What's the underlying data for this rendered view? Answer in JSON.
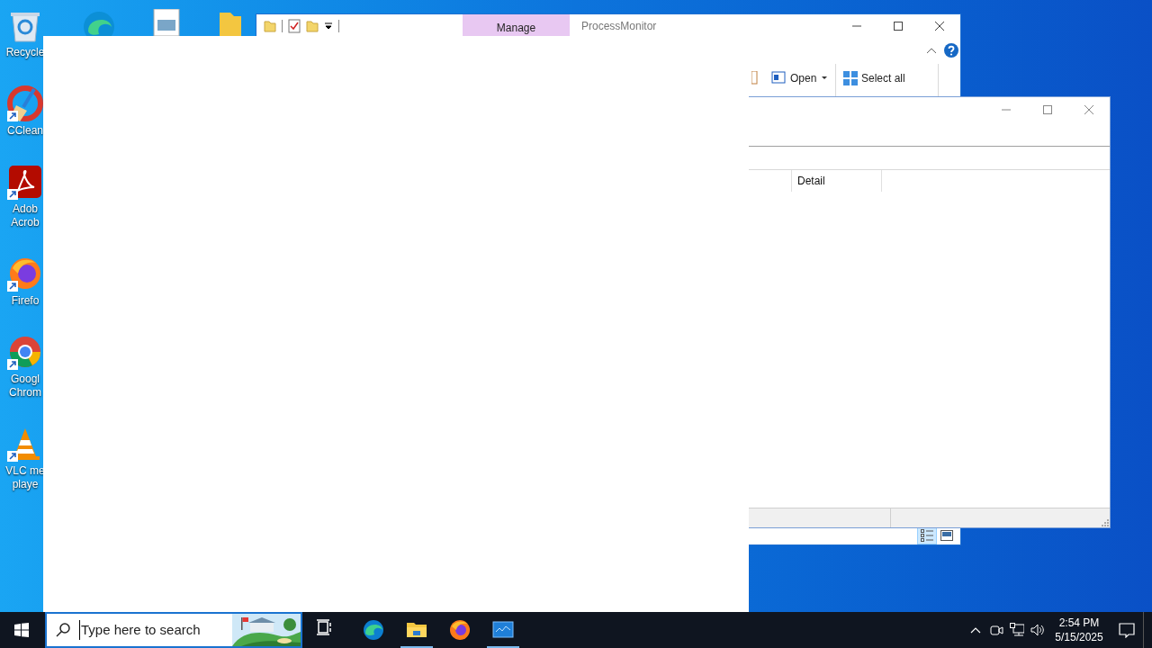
{
  "desktop_icons": [
    {
      "kind": "recycle",
      "lines": [
        "Recycle"
      ]
    },
    {
      "kind": "ccleaner",
      "lines": [
        "CClean"
      ]
    },
    {
      "kind": "acrobat",
      "lines": [
        "Adob",
        "Acrob"
      ]
    },
    {
      "kind": "firefox",
      "lines": [
        "Firefo"
      ]
    },
    {
      "kind": "chrome",
      "lines": [
        "Googl",
        "Chrom"
      ]
    },
    {
      "kind": "vlc",
      "lines": [
        "VLC me",
        "playe"
      ]
    }
  ],
  "explorer_window": {
    "context_tab": "Manage",
    "title": "ProcessMonitor",
    "ribbon": [
      {
        "kind": "open",
        "label": "Open"
      },
      {
        "kind": "select_all",
        "label": "Select all"
      }
    ],
    "view_buttons": [
      {
        "kind": "details",
        "selected": true
      },
      {
        "kind": "preview",
        "selected": false
      }
    ]
  },
  "procmon_window": {
    "columns": [
      "Detail"
    ]
  },
  "taskbar": {
    "search": {
      "placeholder": "Type here to search"
    },
    "apps": [
      {
        "kind": "taskview",
        "running": false
      },
      {
        "kind": "edge",
        "running": false
      },
      {
        "kind": "explorer",
        "running": true
      },
      {
        "kind": "firefox",
        "running": false
      },
      {
        "kind": "monitor",
        "running": true
      }
    ],
    "clock": {
      "time": "2:54 PM",
      "date": "5/15/2025"
    }
  }
}
